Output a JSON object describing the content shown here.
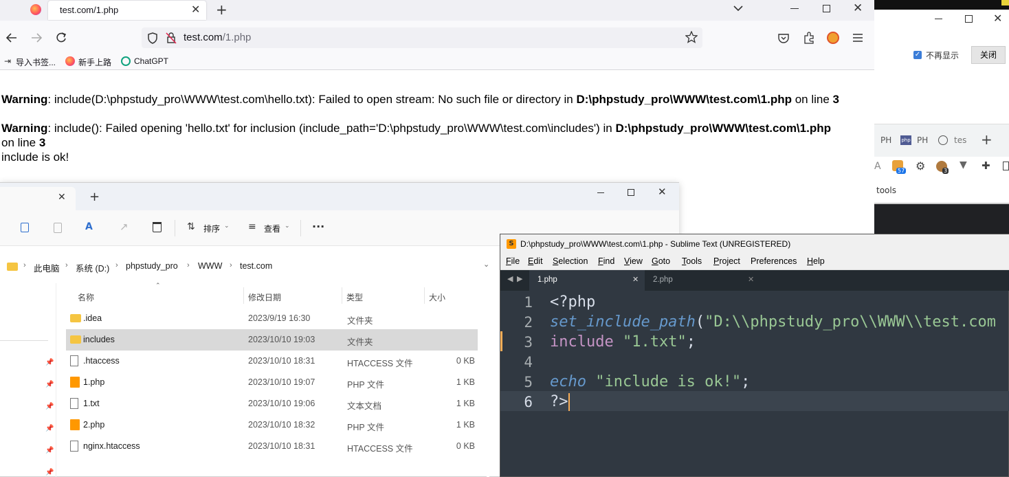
{
  "firefox": {
    "tab_title": "test.com/1.php",
    "url_host": "test.com",
    "url_path": "/1.php",
    "bookmarks": [
      "导入书签...",
      "新手上路",
      "ChatGPT"
    ],
    "content": {
      "w1_label": "Warning",
      "w1_text": ": include(D:\\phpstudy_pro\\WWW\\test.com\\hello.txt): Failed to open stream: No such file or directory in ",
      "w1_file": "D:\\phpstudy_pro\\WWW\\test.com\\1.php",
      "w1_online": " on line ",
      "w1_line": "3",
      "w2_label": "Warning",
      "w2_text": ": include(): Failed opening 'hello.txt' for inclusion (include_path='D:\\phpstudy_pro\\WWW\\test.com\\includes') in ",
      "w2_file": "D:\\phpstudy_pro\\WWW\\test.com\\1.php",
      "w2_online": "on line ",
      "w2_line": "3",
      "output": "include is ok!"
    }
  },
  "right_window": {
    "checkbox_label": "不再显示",
    "close_button": "关闭",
    "tabs": [
      "PH",
      "PH",
      "tes"
    ],
    "badge1": "57",
    "badge2": "3",
    "tools_label": "tools"
  },
  "explorer": {
    "toolbar": {
      "sort": "排序",
      "view": "查看",
      "more": "···"
    },
    "breadcrumb": [
      "此电脑",
      "系统 (D:)",
      "phpstudy_pro",
      "WWW",
      "test.com"
    ],
    "columns": {
      "name": "名称",
      "date": "修改日期",
      "type": "类型",
      "size": "大小"
    },
    "files": [
      {
        "name": ".idea",
        "date": "2023/9/19 16:30",
        "type": "文件夹",
        "size": "",
        "icon": "folder-icon"
      },
      {
        "name": "includes",
        "date": "2023/10/10 19:03",
        "type": "文件夹",
        "size": "",
        "icon": "folder-icon"
      },
      {
        "name": ".htaccess",
        "date": "2023/10/10 18:31",
        "type": "HTACCESS 文件",
        "size": "0 KB",
        "icon": "file-icon"
      },
      {
        "name": "1.php",
        "date": "2023/10/10 19:07",
        "type": "PHP 文件",
        "size": "1 KB",
        "icon": "sublime-file-icon"
      },
      {
        "name": "1.txt",
        "date": "2023/10/10 19:06",
        "type": "文本文档",
        "size": "1 KB",
        "icon": "text-file-icon"
      },
      {
        "name": "2.php",
        "date": "2023/10/10 18:32",
        "type": "PHP 文件",
        "size": "1 KB",
        "icon": "sublime-file-icon"
      },
      {
        "name": "nginx.htaccess",
        "date": "2023/10/10 18:31",
        "type": "HTACCESS 文件",
        "size": "0 KB",
        "icon": "file-icon"
      }
    ]
  },
  "sublime": {
    "title": "D:\\phpstudy_pro\\WWW\\test.com\\1.php - Sublime Text (UNREGISTERED)",
    "menu": [
      {
        "u": "F",
        "rest": "ile"
      },
      {
        "u": "E",
        "rest": "dit"
      },
      {
        "u": "S",
        "rest": "election"
      },
      {
        "u": "F",
        "rest": "ind"
      },
      {
        "u": "V",
        "rest": "iew"
      },
      {
        "u": "G",
        "rest": "oto"
      },
      {
        "u": "T",
        "rest": "ools"
      },
      {
        "u": "P",
        "rest": "roject"
      },
      {
        "u": "",
        "rest": "Preferences"
      },
      {
        "u": "H",
        "rest": "elp"
      }
    ],
    "tabs": [
      "1.php",
      "2.php"
    ],
    "line_numbers": [
      "1",
      "2",
      "3",
      "4",
      "5",
      "6"
    ],
    "code": {
      "l1": "<?php",
      "l2_fn": "set_include_path",
      "l2_paren": "(",
      "l2_str": "\"D:\\\\phpstudy_pro\\\\WWW\\\\test.com",
      "l3_kw": "include",
      "l3_str": "\"1.txt\"",
      "l3_semi": ";",
      "l5_kw": "echo",
      "l5_str": "\"include is ok!\"",
      "l5_semi": ";",
      "l6": "?>"
    }
  }
}
